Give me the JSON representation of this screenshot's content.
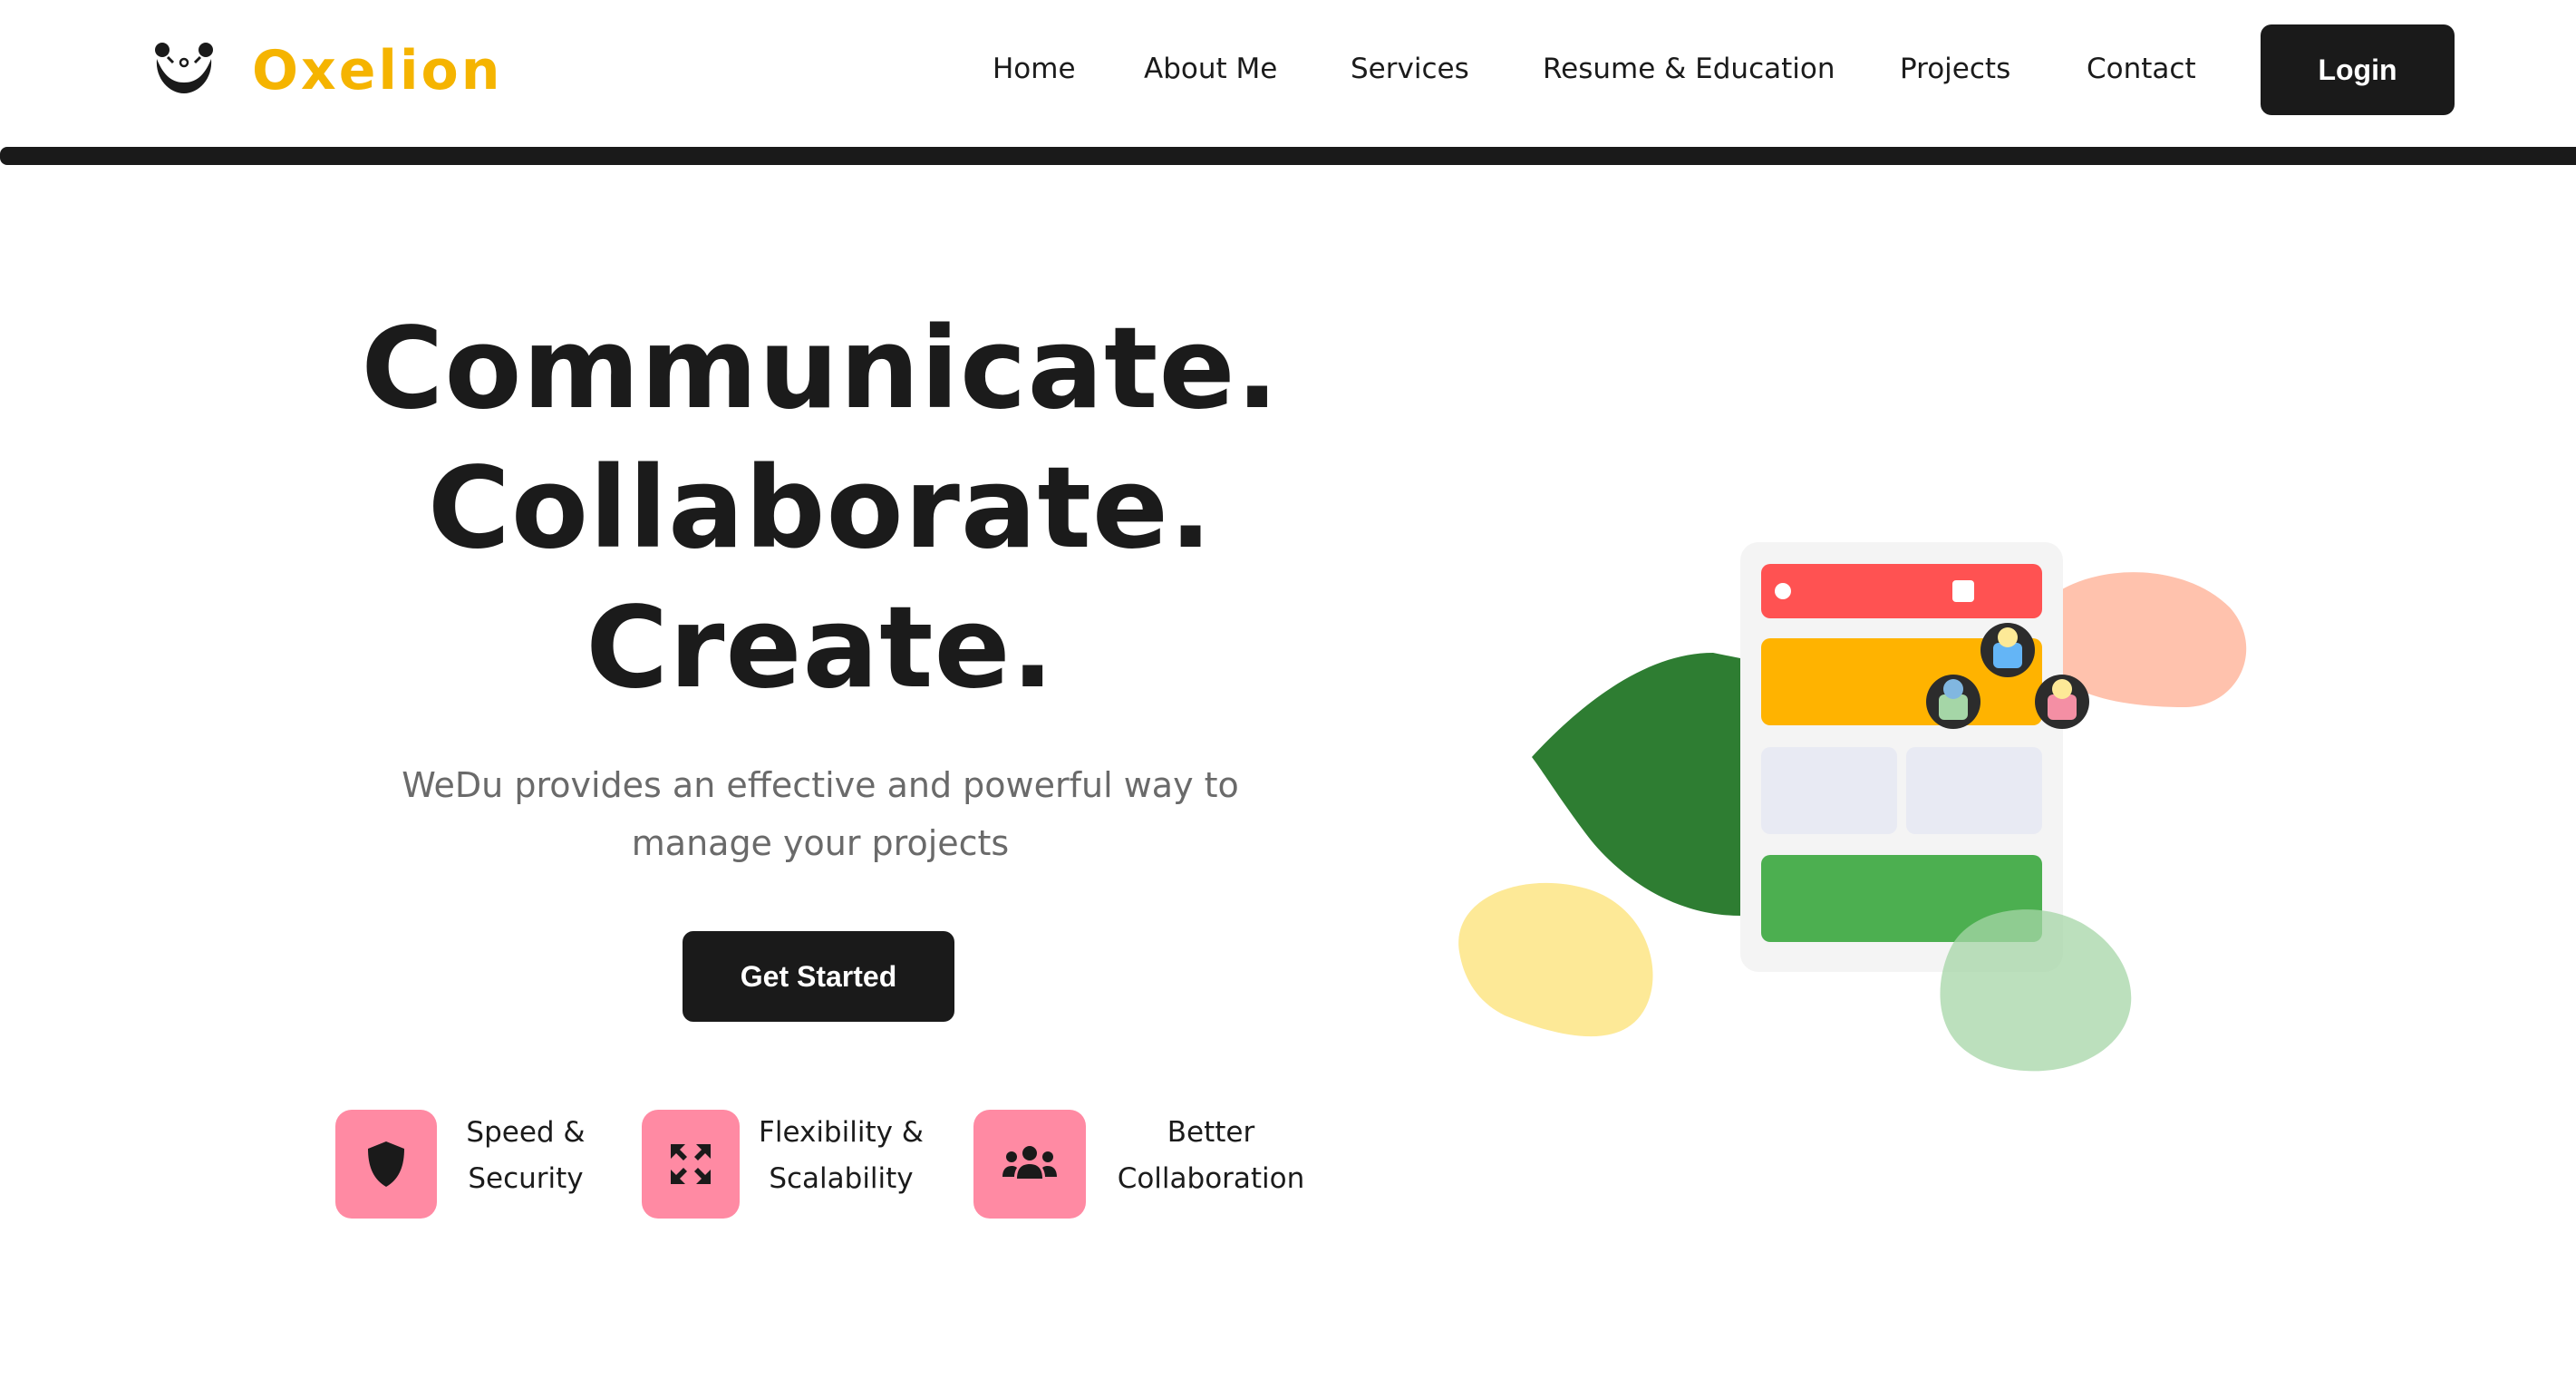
{
  "brand": {
    "name": "Oxelion",
    "color": "#f5b400"
  },
  "nav": {
    "items": [
      "Home",
      "About Me",
      "Services",
      "Resume & Education",
      "Projects",
      "Contact"
    ],
    "login": "Login"
  },
  "hero": {
    "title_lines": [
      "Communicate.",
      "Collaborate.",
      "Create."
    ],
    "subtitle": "WeDu provides an effective and powerful way to manage your projects",
    "cta": "Get Started"
  },
  "features": [
    {
      "icon": "shield-icon",
      "label": "Speed & Security"
    },
    {
      "icon": "expand-arrows-icon",
      "label": "Flexibility & Scalability"
    },
    {
      "icon": "users-icon",
      "label": "Better Collaboration"
    }
  ],
  "colors": {
    "accent_dark": "#1a1a1a",
    "feature_pink": "#ff8aa3",
    "illus_red": "#ff5252",
    "illus_yellow": "#ffb300",
    "illus_green": "#4caf50",
    "leaf_green": "#2e7d32"
  }
}
